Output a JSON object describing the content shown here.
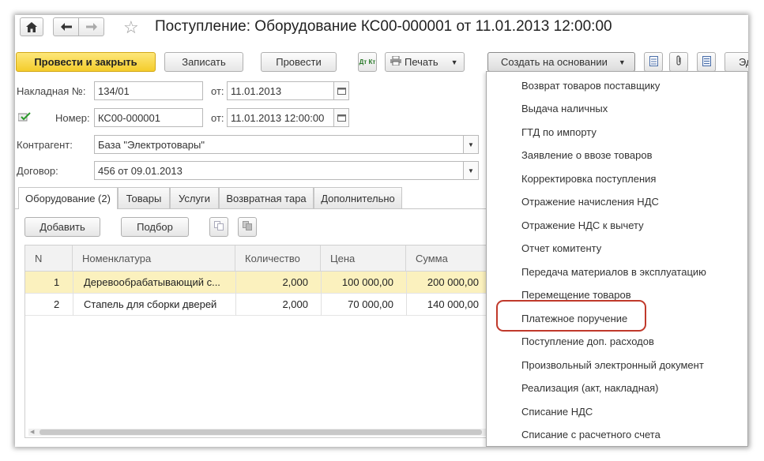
{
  "window": {
    "title": "Поступление: Оборудование КС00-000001 от 11.01.2013 12:00:00",
    "star": "☆",
    "home_icon": "home-icon",
    "back_icon": "arrow-left-icon",
    "forward_icon": "arrow-right-icon"
  },
  "toolbar": {
    "post_close_label": "Провести и закрыть",
    "save_label": "Записать",
    "post_label": "Провести",
    "dtkt_label": "Дт Кт",
    "print_label": "Печать",
    "create_based_label": "Создать на основании",
    "cut_label": "Эд"
  },
  "form": {
    "invoice_label": "Накладная №:",
    "invoice_value": "134/01",
    "invoice_date_label": "от:",
    "invoice_date_value": "11.01.2013",
    "number_label": "Номер:",
    "number_value": "КС00-000001",
    "number_date_label": "от:",
    "number_date_value": "11.01.2013 12:00:00",
    "counterparty_label": "Контрагент:",
    "counterparty_value": "База \"Электротовары\"",
    "contract_label": "Договор:",
    "contract_value": "456 от 09.01.2013"
  },
  "tabs": [
    {
      "label": "Оборудование (2)"
    },
    {
      "label": "Товары"
    },
    {
      "label": "Услуги"
    },
    {
      "label": "Возвратная тара"
    },
    {
      "label": "Дополнительно"
    }
  ],
  "table_toolbar": {
    "add_label": "Добавить",
    "pick_label": "Подбор"
  },
  "table": {
    "columns": [
      "N",
      "Номенклатура",
      "Количество",
      "Цена",
      "Сумма"
    ],
    "rows": [
      {
        "n": "1",
        "name": "Деревообрабатывающий с...",
        "qty": "2,000",
        "price": "100 000,00",
        "sum": "200 000,00"
      },
      {
        "n": "2",
        "name": "Стапель для сборки дверей",
        "qty": "2,000",
        "price": "70 000,00",
        "sum": "140 000,00"
      }
    ]
  },
  "menu": {
    "items": [
      "Возврат товаров поставщику",
      "Выдача наличных",
      "ГТД по импорту",
      "Заявление о ввозе товаров",
      "Корректировка поступления",
      "Отражение начисления НДС",
      "Отражение НДС к вычету",
      "Отчет комитенту",
      "Передача материалов в эксплуатацию",
      "Перемещение товаров",
      "Платежное поручение",
      "Поступление доп. расходов",
      "Произвольный электронный документ",
      "Реализация (акт, накладная)",
      "Списание НДС",
      "Списание с расчетного счета"
    ],
    "highlighted": "Платежное поручение",
    "highlight_color": "#c0392b"
  },
  "colors": {
    "primary_button": "#f4cc2b",
    "selected_row": "#fbf1be"
  }
}
